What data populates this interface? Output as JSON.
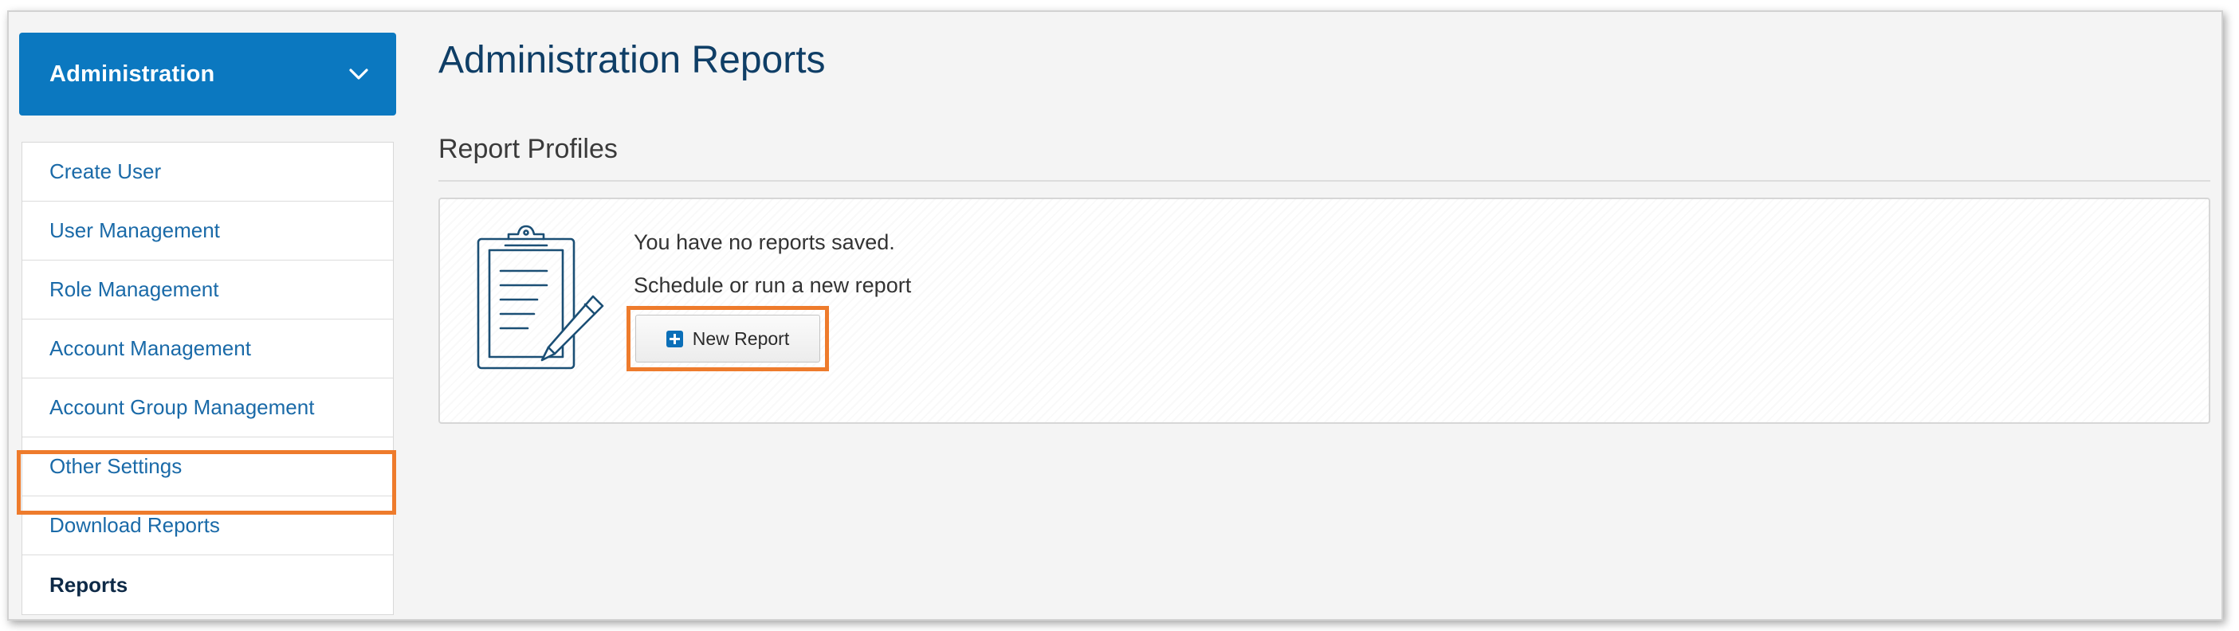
{
  "sidebar": {
    "header": "Administration",
    "items": [
      {
        "label": "Create User"
      },
      {
        "label": "User Management"
      },
      {
        "label": "Role Management"
      },
      {
        "label": "Account Management"
      },
      {
        "label": "Account Group Management"
      },
      {
        "label": "Other Settings"
      },
      {
        "label": "Download Reports"
      },
      {
        "label": "Reports"
      }
    ],
    "active": "Reports"
  },
  "main": {
    "title": "Administration Reports",
    "section_title": "Report Profiles",
    "empty_message": "You have no reports saved.",
    "schedule_message": "Schedule or run a new report",
    "new_report_label": "New Report"
  },
  "icons": {
    "header": "chevron-down-icon",
    "empty_state": "clipboard-edit-icon",
    "button": "plus-square-icon"
  },
  "colors": {
    "accent": "#0b78c0",
    "highlight": "#ee7b2c",
    "title": "#0f3e66",
    "link": "#1a6aa8"
  }
}
